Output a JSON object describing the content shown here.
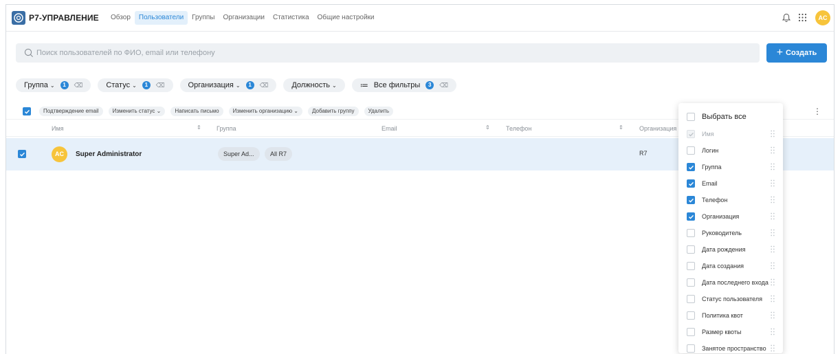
{
  "header": {
    "logo_text": "Р7-УПРАВЛЕНИЕ",
    "nav": [
      {
        "label": "Обзор",
        "active": false
      },
      {
        "label": "Пользователи",
        "active": true
      },
      {
        "label": "Группы",
        "active": false
      },
      {
        "label": "Организации",
        "active": false
      },
      {
        "label": "Статистика",
        "active": false
      },
      {
        "label": "Общие настройки",
        "active": false
      }
    ],
    "icons": [
      "bell-icon",
      "apps-grid-icon"
    ],
    "avatar_initials": "AC"
  },
  "search": {
    "placeholder": "Поиск пользователей по ФИО, email или телефону",
    "value": ""
  },
  "create_button": {
    "label": "Создать"
  },
  "filters": {
    "group": {
      "label": "Группа",
      "count": "1"
    },
    "status": {
      "label": "Статус",
      "count": "1"
    },
    "organization": {
      "label": "Организация",
      "count": "1"
    },
    "position": {
      "label": "Должность"
    },
    "all": {
      "label": "Все фильтры",
      "count": "3"
    }
  },
  "bulk_actions": {
    "select_all_checked": true,
    "confirm_email": "Подтверждение email",
    "change_status": "Изменить статус",
    "write_letter": "Написать письмо",
    "change_org": "Изменить организацию",
    "add_group": "Добавить группу",
    "delete": "Удалить"
  },
  "table": {
    "columns": {
      "name": "Имя",
      "group": "Группа",
      "email": "Email",
      "phone": "Телефон",
      "organization": "Организация"
    },
    "rows": [
      {
        "checked": true,
        "initials": "AC",
        "name": "Super Administrator",
        "groups": [
          "Super Ad...",
          "All R7"
        ],
        "email": "",
        "phone": "",
        "organization": "R7"
      }
    ]
  },
  "column_menu": {
    "select_all": "Выбрать все",
    "items": [
      {
        "label": "Имя",
        "checked": true,
        "disabled": true
      },
      {
        "label": "Логин",
        "checked": false
      },
      {
        "label": "Группа",
        "checked": true
      },
      {
        "label": "Email",
        "checked": true
      },
      {
        "label": "Телефон",
        "checked": true
      },
      {
        "label": "Организация",
        "checked": true
      },
      {
        "label": "Руководитель",
        "checked": false
      },
      {
        "label": "Дата рождения",
        "checked": false
      },
      {
        "label": "Дата создания",
        "checked": false
      },
      {
        "label": "Дата последнего входа",
        "checked": false
      },
      {
        "label": "Статус пользователя",
        "checked": false
      },
      {
        "label": "Политика квот",
        "checked": false
      },
      {
        "label": "Размер квоты",
        "checked": false
      },
      {
        "label": "Занятое пространство",
        "checked": false
      }
    ]
  },
  "colors": {
    "accent": "#2b87d7",
    "avatar": "#f7c43b",
    "selected_row": "#e6f0fa"
  }
}
